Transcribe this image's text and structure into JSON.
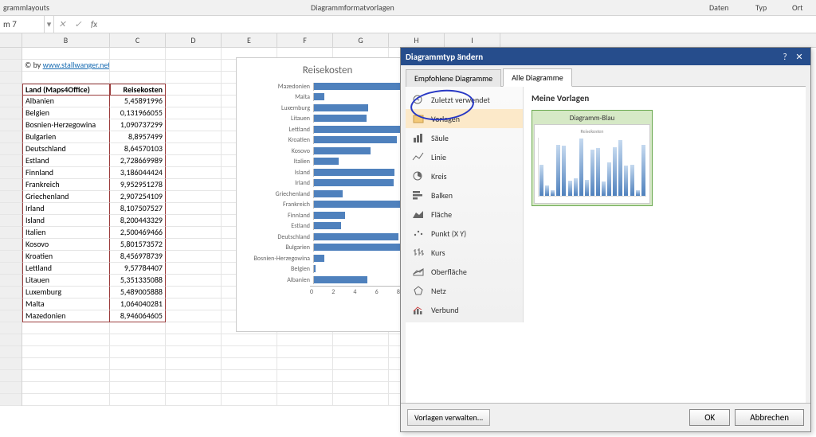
{
  "ribbon": {
    "group_layouts": "grammlayouts",
    "group_styles": "Diagrammformatvorlagen",
    "group_data": "Daten",
    "group_type": "Typ",
    "group_location": "Ort"
  },
  "formula_bar": {
    "name_box": "m 7",
    "fx": "fx"
  },
  "columns": [
    "B",
    "C",
    "D",
    "E",
    "F",
    "G",
    "H",
    "I"
  ],
  "copyright": {
    "prefix": "© by ",
    "link": "www.stallwanger.net"
  },
  "table": {
    "headers": {
      "land": "Land (Maps4Office)",
      "kosten": "Reisekosten"
    },
    "rows": [
      {
        "land": "Albanien",
        "kosten": "5,45891996"
      },
      {
        "land": "Belgien",
        "kosten": "0,131966055"
      },
      {
        "land": "Bosnien-Herzegowina",
        "kosten": "1,090737299"
      },
      {
        "land": "Bulgarien",
        "kosten": "8,8957499"
      },
      {
        "land": "Deutschland",
        "kosten": "8,64570103"
      },
      {
        "land": "Estland",
        "kosten": "2,728669989"
      },
      {
        "land": "Finnland",
        "kosten": "3,186044424"
      },
      {
        "land": "Frankreich",
        "kosten": "9,952951278"
      },
      {
        "land": "Griechenland",
        "kosten": "2,907254109"
      },
      {
        "land": "Irland",
        "kosten": "8,107507527"
      },
      {
        "land": "Island",
        "kosten": "8,200443329"
      },
      {
        "land": "Italien",
        "kosten": "2,500469466"
      },
      {
        "land": "Kosovo",
        "kosten": "5,801573572"
      },
      {
        "land": "Kroatien",
        "kosten": "8,456978739"
      },
      {
        "land": "Lettland",
        "kosten": "9,57784407"
      },
      {
        "land": "Litauen",
        "kosten": "5,351335088"
      },
      {
        "land": "Luxemburg",
        "kosten": "5,489005888"
      },
      {
        "land": "Malta",
        "kosten": "1,064040281"
      },
      {
        "land": "Mazedonien",
        "kosten": "8,946064605"
      }
    ]
  },
  "chart_data": {
    "type": "bar",
    "title": "Reisekosten",
    "xlabel": "",
    "ylabel": "",
    "xlim": [
      0,
      10
    ],
    "ticks": [
      "0",
      "2",
      "4",
      "6",
      "8"
    ],
    "categories": [
      "Mazedonien",
      "Malta",
      "Luxemburg",
      "Litauen",
      "Lettland",
      "Kroatien",
      "Kosovo",
      "Italien",
      "Island",
      "Irland",
      "Griechenland",
      "Frankreich",
      "Finnland",
      "Estland",
      "Deutschland",
      "Bulgarien",
      "Bosnien-Herzegowina",
      "Belgien",
      "Albanien"
    ],
    "values": [
      8.95,
      1.06,
      5.49,
      5.35,
      9.58,
      8.46,
      5.8,
      2.5,
      8.2,
      8.11,
      2.91,
      9.95,
      3.19,
      2.73,
      8.65,
      8.9,
      1.09,
      0.13,
      5.46
    ]
  },
  "dialog": {
    "title": "Diagrammtyp ändern",
    "tabs": {
      "recommended": "Empfohlene Diagramme",
      "all": "Alle Diagramme"
    },
    "types": [
      {
        "id": "recent",
        "label": "Zuletzt verwendet"
      },
      {
        "id": "templates",
        "label": "Vorlagen"
      },
      {
        "id": "column",
        "label": "Säule"
      },
      {
        "id": "line",
        "label": "Linie"
      },
      {
        "id": "pie",
        "label": "Kreis"
      },
      {
        "id": "bar",
        "label": "Balken"
      },
      {
        "id": "area",
        "label": "Fläche"
      },
      {
        "id": "xy",
        "label": "Punkt (X Y)"
      },
      {
        "id": "stock",
        "label": "Kurs"
      },
      {
        "id": "surface",
        "label": "Oberfläche"
      },
      {
        "id": "radar",
        "label": "Netz"
      },
      {
        "id": "combo",
        "label": "Verbund"
      }
    ],
    "pane_title": "Meine Vorlagen",
    "template_name": "Diagramm-Blau",
    "thumb_title": "Reisekosten",
    "thumb_bars": [
      54,
      18,
      10,
      88,
      86,
      26,
      30,
      98,
      28,
      80,
      82,
      24,
      58,
      84,
      96,
      52,
      54,
      10,
      88
    ],
    "manage": "Vorlagen verwalten...",
    "ok": "OK",
    "cancel": "Abbrechen"
  }
}
